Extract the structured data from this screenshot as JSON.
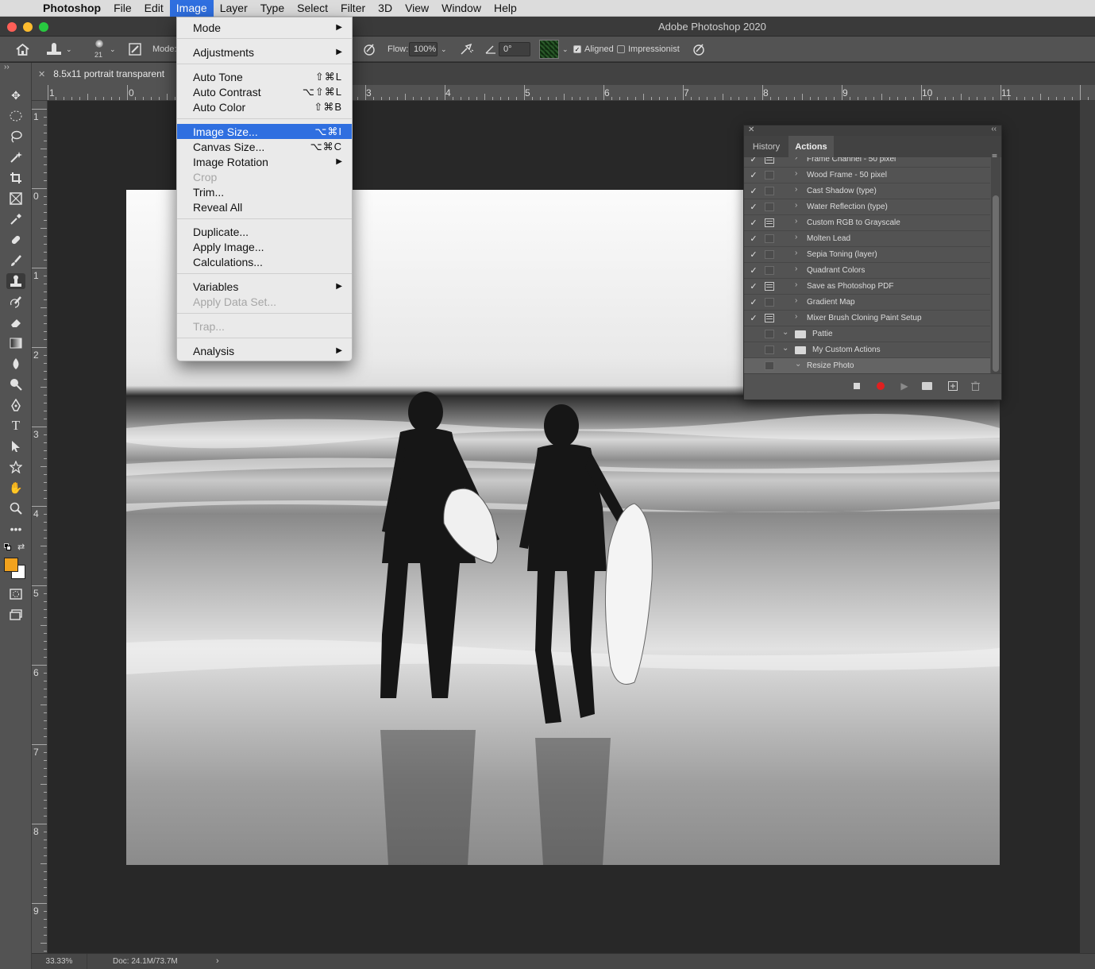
{
  "menubar": {
    "items": [
      "Photoshop",
      "File",
      "Edit",
      "Image",
      "Layer",
      "Type",
      "Select",
      "Filter",
      "3D",
      "View",
      "Window",
      "Help"
    ],
    "active": "Image"
  },
  "window": {
    "title": "Adobe Photoshop 2020"
  },
  "options": {
    "brush_size": "21",
    "mode_label": "Mode:",
    "flow_label": "Flow:",
    "flow_value": "100%",
    "angle_value": "0°",
    "aligned_label": "Aligned",
    "aligned_checked": true,
    "impressionist_label": "Impressionist",
    "impressionist_checked": false
  },
  "document": {
    "tab_title": "8.5x11 portrait transparent"
  },
  "rulers": {
    "horizontal": [
      "1",
      "0",
      "3",
      "4",
      "5",
      "6",
      "7",
      "8",
      "9",
      "10",
      "11"
    ],
    "vertical": [
      "1",
      "0",
      "1",
      "2",
      "3",
      "4",
      "5",
      "6",
      "7",
      "8",
      "9"
    ]
  },
  "image_menu": {
    "items": [
      {
        "label": "Mode",
        "submenu": true
      },
      {
        "label": "Adjustments",
        "submenu": true
      },
      {
        "label": "Auto Tone",
        "shortcut": "⇧⌘L"
      },
      {
        "label": "Auto Contrast",
        "shortcut": "⌥⇧⌘L"
      },
      {
        "label": "Auto Color",
        "shortcut": "⇧⌘B"
      },
      {
        "label": "Image Size...",
        "shortcut": "⌥⌘I",
        "highlighted": true
      },
      {
        "label": "Canvas Size...",
        "shortcut": "⌥⌘C"
      },
      {
        "label": "Image Rotation",
        "submenu": true
      },
      {
        "label": "Crop",
        "disabled": true
      },
      {
        "label": "Trim..."
      },
      {
        "label": "Reveal All"
      },
      {
        "label": "Duplicate..."
      },
      {
        "label": "Apply Image..."
      },
      {
        "label": "Calculations..."
      },
      {
        "label": "Variables",
        "submenu": true
      },
      {
        "label": "Apply Data Set...",
        "disabled": true
      },
      {
        "label": "Trap...",
        "disabled": true
      },
      {
        "label": "Analysis",
        "submenu": true
      }
    ]
  },
  "actions_panel": {
    "tabs": [
      "History",
      "Actions"
    ],
    "active_tab": "Actions",
    "rows": [
      {
        "label": "Frame Channel - 50 pixel",
        "checked": true,
        "dialog": true
      },
      {
        "label": "Wood Frame - 50 pixel",
        "checked": true,
        "dialog": false
      },
      {
        "label": "Cast Shadow (type)",
        "checked": true,
        "dialog": false
      },
      {
        "label": "Water Reflection (type)",
        "checked": true,
        "dialog": false
      },
      {
        "label": "Custom RGB to Grayscale",
        "checked": true,
        "dialog": true
      },
      {
        "label": "Molten Lead",
        "checked": true,
        "dialog": false
      },
      {
        "label": "Sepia Toning (layer)",
        "checked": true,
        "dialog": false
      },
      {
        "label": "Quadrant Colors",
        "checked": true,
        "dialog": false
      },
      {
        "label": "Save as Photoshop PDF",
        "checked": true,
        "dialog": true
      },
      {
        "label": "Gradient Map",
        "checked": true,
        "dialog": false
      },
      {
        "label": "Mixer Brush Cloning Paint Setup",
        "checked": true,
        "dialog": true
      },
      {
        "label": "Pattie",
        "checked": false,
        "dialog": false,
        "set": true
      },
      {
        "label": "My Custom Actions",
        "checked": false,
        "dialog": false,
        "set": true
      },
      {
        "label": "Resize Photo",
        "checked": false,
        "dialog": false,
        "selected": true
      }
    ]
  },
  "status": {
    "zoom": "33.33%",
    "doc": "Doc: 24.1M/73.7M"
  },
  "colors": {
    "accent": "#2f6fe0",
    "foreground": "#f2a21d",
    "background": "#ffffff",
    "record": "#e02020"
  }
}
